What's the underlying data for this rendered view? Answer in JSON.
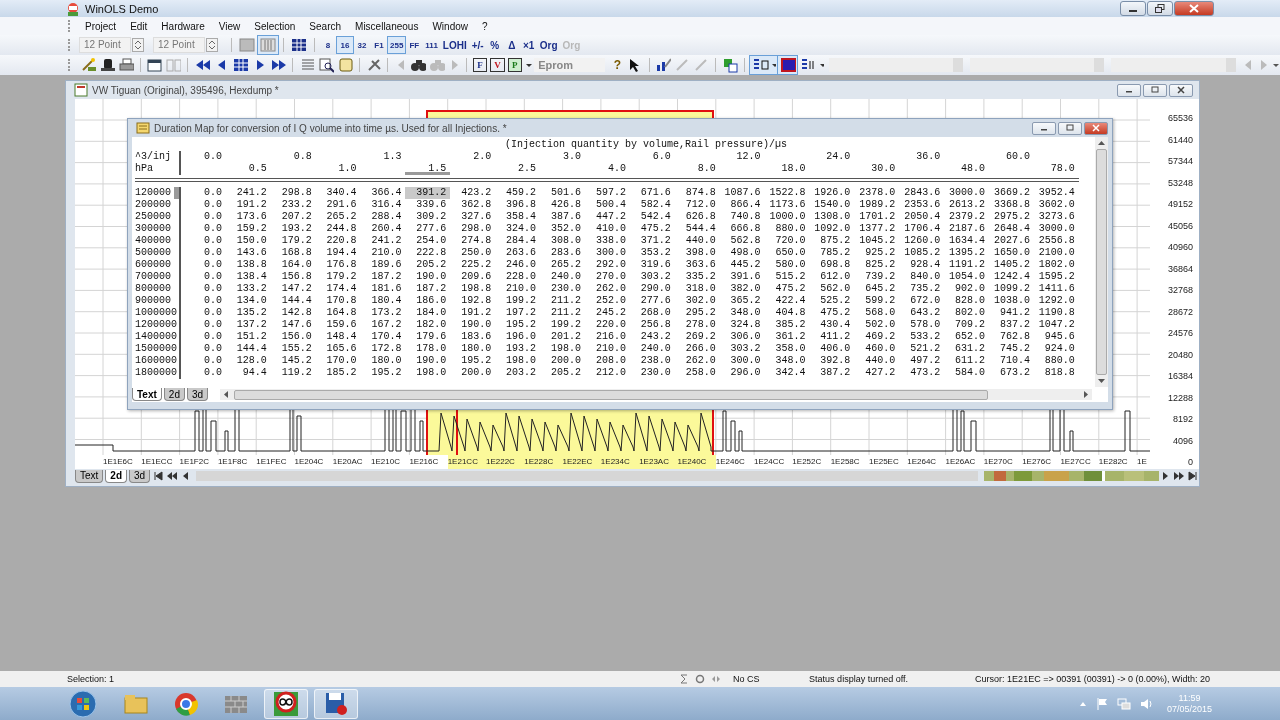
{
  "app": {
    "title": "WinOLS Demo"
  },
  "menu": [
    "Project",
    "Edit",
    "Hardware",
    "View",
    "Selection",
    "Search",
    "Miscellaneous",
    "Window",
    "?"
  ],
  "toolbar": {
    "font_sizes": [
      "12 Point",
      "12 Point"
    ],
    "view_buttons": [
      {
        "label": "8",
        "selected": false
      },
      {
        "label": "16",
        "selected": true
      },
      {
        "label": "32",
        "selected": false
      },
      {
        "label": "F1",
        "selected": false
      },
      {
        "label": "255",
        "selected": true
      },
      {
        "label": "FF",
        "selected": false
      },
      {
        "label": "111",
        "selected": false
      }
    ],
    "ops": [
      {
        "label": "LOHI",
        "disabled": false
      },
      {
        "label": "+/-",
        "disabled": false
      },
      {
        "label": "%",
        "disabled": false
      },
      {
        "label": "Δ",
        "disabled": false
      },
      {
        "label": "×1",
        "disabled": false
      },
      {
        "label": "Org",
        "disabled": false
      },
      {
        "label": "Org",
        "disabled": true
      }
    ],
    "mode_buttons": [
      "F",
      "V",
      "P"
    ],
    "eprom": "Eprom",
    "help": "?"
  },
  "hexdump_window": {
    "title": "VW Tiguan (Original), 395496, Hexdump *",
    "y_axis": [
      "65536",
      "61440",
      "57344",
      "53248",
      "49152",
      "45056",
      "40960",
      "36864",
      "32768",
      "28672",
      "24576",
      "20480",
      "16384",
      "12288",
      "8192",
      "4096",
      "0"
    ],
    "x_axis": [
      {
        "label": "1E1E6C",
        "selected": false
      },
      {
        "label": "1E1ECC",
        "selected": false
      },
      {
        "label": "1E1F2C",
        "selected": false
      },
      {
        "label": "1E1F8C",
        "selected": false
      },
      {
        "label": "1E1FEC",
        "selected": false
      },
      {
        "label": "1E204C",
        "selected": false
      },
      {
        "label": "1E20AC",
        "selected": false
      },
      {
        "label": "1E210C",
        "selected": false
      },
      {
        "label": "1E216C",
        "selected": false
      },
      {
        "label": "1E21CC",
        "selected": true
      },
      {
        "label": "1E222C",
        "selected": true
      },
      {
        "label": "1E228C",
        "selected": true
      },
      {
        "label": "1E22EC",
        "selected": true
      },
      {
        "label": "1E234C",
        "selected": true
      },
      {
        "label": "1E23AC",
        "selected": true
      },
      {
        "label": "1E240C",
        "selected": true
      },
      {
        "label": "1E246C",
        "selected": false
      },
      {
        "label": "1E24CC",
        "selected": false
      },
      {
        "label": "1E252C",
        "selected": false
      },
      {
        "label": "1E258C",
        "selected": false
      },
      {
        "label": "1E25EC",
        "selected": false
      },
      {
        "label": "1E264C",
        "selected": false
      },
      {
        "label": "1E26AC",
        "selected": false
      },
      {
        "label": "1E270C",
        "selected": false
      },
      {
        "label": "1E276C",
        "selected": false
      },
      {
        "label": "1E27CC",
        "selected": false
      },
      {
        "label": "1E282C",
        "selected": false
      },
      {
        "label": "1E",
        "selected": false
      }
    ],
    "tabs": [
      {
        "label": "Text",
        "selected": false
      },
      {
        "label": "2d",
        "selected": true
      },
      {
        "label": "3d",
        "selected": false
      }
    ]
  },
  "map_window": {
    "title": "Duration Map for  conversion of I Q volume  into time µs. Used for all Injections. *",
    "quantity": "(Injection quantity by volume,Rail pressure)/µs",
    "x_unit": "^3/inj",
    "y_unit": "hPa",
    "columns": [
      {
        "label": "0.0",
        "selected": false
      },
      {
        "label": "0.5",
        "selected": false
      },
      {
        "label": "0.8",
        "selected": false
      },
      {
        "label": "1.0",
        "selected": false
      },
      {
        "label": "1.3",
        "selected": false
      },
      {
        "label": "1.5",
        "selected": true
      },
      {
        "label": "2.0",
        "selected": false
      },
      {
        "label": "2.5",
        "selected": false
      },
      {
        "label": "3.0",
        "selected": false
      },
      {
        "label": "4.0",
        "selected": false
      },
      {
        "label": "6.0",
        "selected": false
      },
      {
        "label": "8.0",
        "selected": false
      },
      {
        "label": "12.0",
        "selected": false
      },
      {
        "label": "18.0",
        "selected": false
      },
      {
        "label": "24.0",
        "selected": false
      },
      {
        "label": "30.0",
        "selected": false
      },
      {
        "label": "36.0",
        "selected": false
      },
      {
        "label": "48.0",
        "selected": false
      },
      {
        "label": "60.0",
        "selected": false
      },
      {
        "label": "78.0",
        "selected": false
      }
    ],
    "rows": [
      {
        "label": "120000",
        "selected": true,
        "values": [
          "0.0",
          "241.2",
          "298.8",
          "340.4",
          "366.4",
          "391.2",
          "423.2",
          "459.2",
          "501.6",
          "597.2",
          "671.6",
          "874.8",
          "1087.6",
          "1522.8",
          "1926.0",
          "2378.0",
          "2843.6",
          "3000.0",
          "3669.2",
          "3952.4"
        ]
      },
      {
        "label": "200000",
        "selected": false,
        "values": [
          "0.0",
          "191.2",
          "233.2",
          "291.6",
          "316.4",
          "339.6",
          "362.8",
          "396.8",
          "426.8",
          "500.4",
          "582.4",
          "712.0",
          "866.4",
          "1173.6",
          "1540.0",
          "1989.2",
          "2353.6",
          "2613.2",
          "3368.8",
          "3602.0"
        ]
      },
      {
        "label": "250000",
        "selected": false,
        "values": [
          "0.0",
          "173.6",
          "207.2",
          "265.2",
          "288.4",
          "309.2",
          "327.6",
          "358.4",
          "387.6",
          "447.2",
          "542.4",
          "626.8",
          "740.8",
          "1000.0",
          "1308.0",
          "1701.2",
          "2050.4",
          "2379.2",
          "2975.2",
          "3273.6"
        ]
      },
      {
        "label": "300000",
        "selected": false,
        "values": [
          "0.0",
          "159.2",
          "193.2",
          "244.8",
          "260.4",
          "277.6",
          "298.0",
          "324.0",
          "352.0",
          "410.0",
          "475.2",
          "544.4",
          "666.8",
          "880.0",
          "1092.0",
          "1377.2",
          "1706.4",
          "2187.6",
          "2648.4",
          "3000.0"
        ]
      },
      {
        "label": "400000",
        "selected": false,
        "values": [
          "0.0",
          "150.0",
          "179.2",
          "220.8",
          "241.2",
          "254.0",
          "274.8",
          "284.4",
          "308.0",
          "338.0",
          "371.2",
          "440.0",
          "562.8",
          "720.0",
          "875.2",
          "1045.2",
          "1260.0",
          "1634.4",
          "2027.6",
          "2556.8"
        ]
      },
      {
        "label": "500000",
        "selected": false,
        "values": [
          "0.0",
          "143.6",
          "168.8",
          "194.4",
          "210.0",
          "222.8",
          "250.0",
          "263.6",
          "283.6",
          "300.0",
          "353.2",
          "398.0",
          "498.0",
          "650.0",
          "785.2",
          "925.2",
          "1085.2",
          "1395.2",
          "1650.0",
          "2100.0"
        ]
      },
      {
        "label": "600000",
        "selected": false,
        "values": [
          "0.0",
          "138.8",
          "164.0",
          "176.8",
          "189.6",
          "205.2",
          "225.2",
          "246.0",
          "265.2",
          "292.0",
          "319.6",
          "363.6",
          "445.2",
          "580.0",
          "698.8",
          "825.2",
          "928.4",
          "1191.2",
          "1405.2",
          "1802.0"
        ]
      },
      {
        "label": "700000",
        "selected": false,
        "values": [
          "0.0",
          "138.4",
          "156.8",
          "179.2",
          "187.2",
          "190.0",
          "209.6",
          "228.0",
          "240.0",
          "270.0",
          "303.2",
          "335.2",
          "391.6",
          "515.2",
          "612.0",
          "739.2",
          "840.0",
          "1054.0",
          "1242.4",
          "1595.2"
        ]
      },
      {
        "label": "800000",
        "selected": false,
        "values": [
          "0.0",
          "133.2",
          "147.2",
          "174.4",
          "181.6",
          "187.2",
          "198.8",
          "210.0",
          "230.0",
          "262.0",
          "290.0",
          "318.0",
          "382.0",
          "475.2",
          "562.0",
          "645.2",
          "735.2",
          "902.0",
          "1099.2",
          "1411.6"
        ]
      },
      {
        "label": "900000",
        "selected": false,
        "values": [
          "0.0",
          "134.0",
          "144.4",
          "170.8",
          "180.4",
          "186.0",
          "192.8",
          "199.2",
          "211.2",
          "252.0",
          "277.6",
          "302.0",
          "365.2",
          "422.4",
          "525.2",
          "599.2",
          "672.0",
          "828.0",
          "1038.0",
          "1292.0"
        ]
      },
      {
        "label": "1000000",
        "selected": false,
        "values": [
          "0.0",
          "135.2",
          "142.8",
          "164.8",
          "173.2",
          "184.0",
          "191.2",
          "197.2",
          "211.2",
          "245.2",
          "268.0",
          "295.2",
          "348.0",
          "404.8",
          "475.2",
          "568.0",
          "643.2",
          "802.0",
          "941.2",
          "1190.8"
        ]
      },
      {
        "label": "1200000",
        "selected": false,
        "values": [
          "0.0",
          "137.2",
          "147.6",
          "159.6",
          "167.2",
          "182.0",
          "190.0",
          "195.2",
          "199.2",
          "220.0",
          "256.8",
          "278.0",
          "324.8",
          "385.2",
          "430.4",
          "502.0",
          "578.0",
          "709.2",
          "837.2",
          "1047.2"
        ]
      },
      {
        "label": "1400000",
        "selected": false,
        "values": [
          "0.0",
          "151.2",
          "156.0",
          "148.4",
          "170.4",
          "179.6",
          "183.6",
          "196.0",
          "201.2",
          "216.0",
          "243.2",
          "269.2",
          "306.0",
          "361.2",
          "411.2",
          "469.2",
          "533.2",
          "652.0",
          "762.8",
          "945.6"
        ]
      },
      {
        "label": "1500000",
        "selected": false,
        "values": [
          "0.0",
          "144.4",
          "155.2",
          "165.6",
          "172.8",
          "178.0",
          "180.0",
          "193.2",
          "198.0",
          "210.0",
          "240.0",
          "266.0",
          "303.2",
          "358.0",
          "406.0",
          "460.0",
          "521.2",
          "631.2",
          "745.2",
          "924.0"
        ]
      },
      {
        "label": "1600000",
        "selected": false,
        "values": [
          "0.0",
          "128.0",
          "145.2",
          "170.0",
          "180.0",
          "190.0",
          "195.2",
          "198.0",
          "200.0",
          "208.0",
          "238.0",
          "262.0",
          "300.0",
          "348.0",
          "392.8",
          "440.0",
          "497.2",
          "611.2",
          "710.4",
          "880.0"
        ]
      },
      {
        "label": "1800000",
        "selected": false,
        "values": [
          "0.0",
          "94.4",
          "119.2",
          "185.2",
          "195.2",
          "198.0",
          "200.0",
          "203.2",
          "205.2",
          "212.0",
          "230.0",
          "258.0",
          "296.0",
          "342.4",
          "387.2",
          "427.2",
          "473.2",
          "584.0",
          "673.2",
          "818.8"
        ]
      }
    ],
    "tabs": [
      {
        "label": "Text",
        "selected": true
      },
      {
        "label": "2d",
        "selected": false
      },
      {
        "label": "3d",
        "selected": false
      }
    ]
  },
  "status_bar": {
    "selection": "Selection: 1",
    "checksum": "No CS",
    "message": "Status display turned off.",
    "cursor": "Cursor: 1E21EC => 00391 (00391) -> 0 (0.00%), Width: 20"
  },
  "taskbar": {
    "time": "11:59",
    "date": "07/05/2015"
  }
}
